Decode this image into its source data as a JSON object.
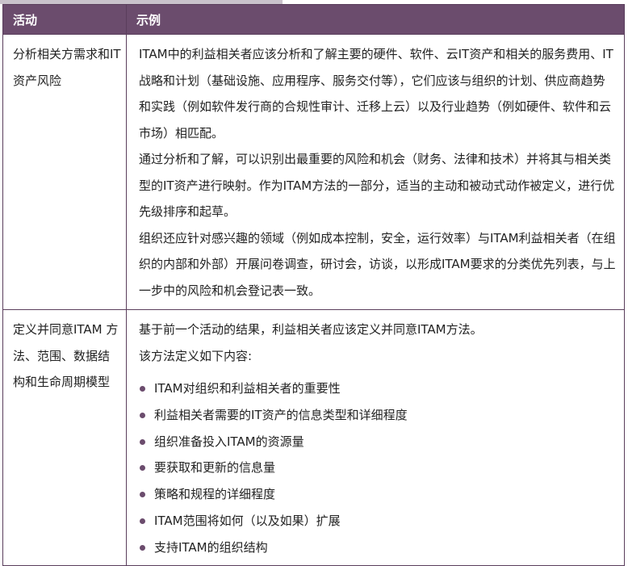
{
  "table": {
    "header": {
      "activity": "活动",
      "example": "示例"
    },
    "rows": [
      {
        "activity": "分析相关方需求和IT资产风险",
        "paragraphs": [
          "ITAM中的利益相关者应该分析和了解主要的硬件、软件、云IT资产和相关的服务费用、IT战略和计划（基础设施、应用程序、服务交付等），它们应该与组织的计划、供应商趋势和实践（例如软件发行商的合规性审计、迁移上云）以及行业趋势（例如硬件、软件和云市场）相匹配。",
          "通过分析和了解，可以识别出最重要的风险和机会（财务、法律和技术）并将其与相关类型的IT资产进行映射。作为ITAM方法的一部分，适当的主动和被动式动作被定义，进行优先级排序和起草。",
          "组织还应针对感兴趣的领域（例如成本控制，安全，运行效率）与ITAM利益相关者（在组织的内部和外部）开展问卷调查，研讨会，访谈，以形成ITAM要求的分类优先列表，与上一步中的风险和机会登记表一致。"
        ]
      },
      {
        "activity": "定义并同意ITAM 方法、范围、数据结构和生命周期模型",
        "paragraphs": [
          "基于前一个活动的结果，利益相关者应该定义并同意ITAM方法。",
          "该方法定义如下内容:"
        ],
        "bullets": [
          "ITAM对组织和利益相关者的重要性",
          "利益相关者需要的IT资产的信息类型和详细程度",
          "组织准备投入ITAM的资源量",
          "要获取和更新的信息量",
          "策略和规程的详细程度",
          "ITAM范围将如何（以及如果）扩展",
          "支持ITAM的组织结构"
        ]
      }
    ]
  },
  "colors": {
    "header_bg": "#6b4c6d",
    "header_text": "#ffffff",
    "border": "#5a3e5c",
    "bullet": "#6b4c6d"
  }
}
